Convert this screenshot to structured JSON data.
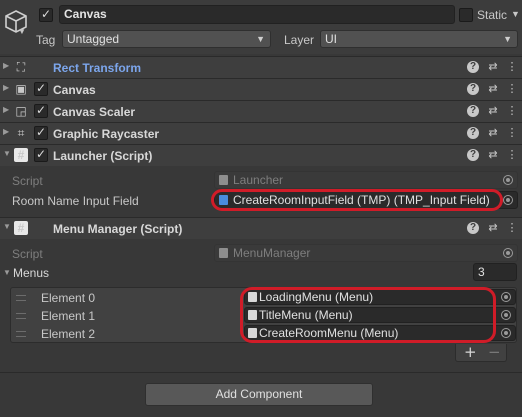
{
  "gameobject": {
    "active": true,
    "name": "Canvas",
    "static_label": "Static",
    "static_checked": false,
    "tag_label": "Tag",
    "tag_value": "Untagged",
    "layer_label": "Layer",
    "layer_value": "UI"
  },
  "components": [
    {
      "title": "Rect Transform",
      "icon": "rect-transform-icon",
      "has_checkbox": false
    },
    {
      "title": "Canvas",
      "icon": "canvas-icon",
      "has_checkbox": true
    },
    {
      "title": "Canvas Scaler",
      "icon": "canvas-scaler-icon",
      "has_checkbox": true
    },
    {
      "title": "Graphic Raycaster",
      "icon": "graphic-raycaster-icon",
      "has_checkbox": true
    },
    {
      "title": "Launcher (Script)",
      "icon": "script-icon",
      "has_checkbox": true
    },
    {
      "title": "Menu Manager (Script)",
      "icon": "script-icon",
      "has_checkbox": false
    }
  ],
  "launcher": {
    "script_label": "Script",
    "script_value": "Launcher",
    "field_label": "Room Name Input Field",
    "field_value": "CreateRoomInputField (TMP) (TMP_Input Field)"
  },
  "menu_manager": {
    "script_label": "Script",
    "script_value": "MenuManager",
    "menus_label": "Menus",
    "menus_count": "3",
    "elements": [
      {
        "label": "Element 0",
        "value": "LoadingMenu (Menu)"
      },
      {
        "label": "Element 1",
        "value": "TitleMenu (Menu)"
      },
      {
        "label": "Element 2",
        "value": "CreateRoomMenu (Menu)"
      }
    ],
    "add_glyph": "+",
    "remove_glyph": "−"
  },
  "add_component_label": "Add Component",
  "colors": {
    "background": "#383838",
    "highlight_ring": "#d01c28",
    "rect_transform_title": "#7ca6ec"
  }
}
